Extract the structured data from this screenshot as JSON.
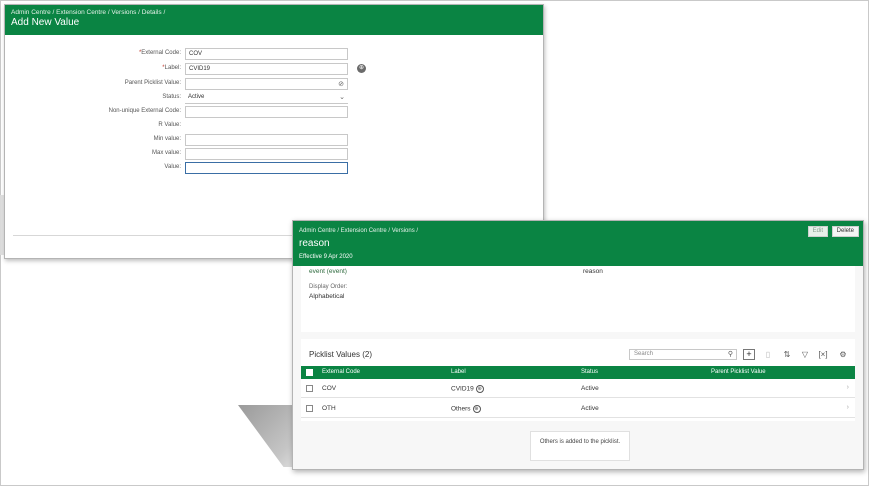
{
  "add_value_window": {
    "breadcrumb": "Admin Centre / Extension Centre / Versions / Details /",
    "title": "Add New Value",
    "fields": {
      "external_code": {
        "label": "External Code:",
        "value": "COV"
      },
      "label": {
        "label": "Label:",
        "value": "CVID19"
      },
      "parent_picklist": {
        "label": "Parent Picklist Value:",
        "value": ""
      },
      "status": {
        "label": "Status:",
        "value": "Active"
      },
      "non_unique_code": {
        "label": "Non-unique External Code:",
        "value": ""
      },
      "r_value": {
        "label": "R Value:",
        "value": ""
      },
      "min_value": {
        "label": "Min value:",
        "value": ""
      },
      "max_value": {
        "label": "Max value:",
        "value": ""
      },
      "value": {
        "label": "Value:",
        "value": ""
      }
    }
  },
  "picklist_window": {
    "breadcrumb": "Admin Centre / Extension Centre / Versions /",
    "title": "reason",
    "effective": "Effective 9 Apr 2020",
    "edit_button": "Edit",
    "delete_button": "Delete",
    "event_link": "event (event)",
    "event_value": "reason",
    "display_order_label": "Display Order:",
    "display_order_value": "Alphabetical",
    "section_title": "Picklist Values (2)",
    "search_placeholder": "Search",
    "columns": [
      "External Code",
      "Label",
      "Status",
      "Parent Picklist Value"
    ],
    "rows": [
      {
        "code": "COV",
        "label": "CVID19",
        "status": "Active",
        "parent": ""
      },
      {
        "code": "OTH",
        "label": "Others",
        "status": "Active",
        "parent": ""
      }
    ],
    "toast": "Others is added to the picklist."
  },
  "colors": {
    "brand_green": "#0a8443",
    "required_star": "#c0392b"
  },
  "icons": [
    "globe-icon",
    "link-icon",
    "chevron-down-icon",
    "search-icon",
    "add-icon",
    "trash-icon",
    "sort-icon",
    "filter-icon",
    "columns-icon",
    "settings-icon",
    "chevron-right-icon"
  ]
}
